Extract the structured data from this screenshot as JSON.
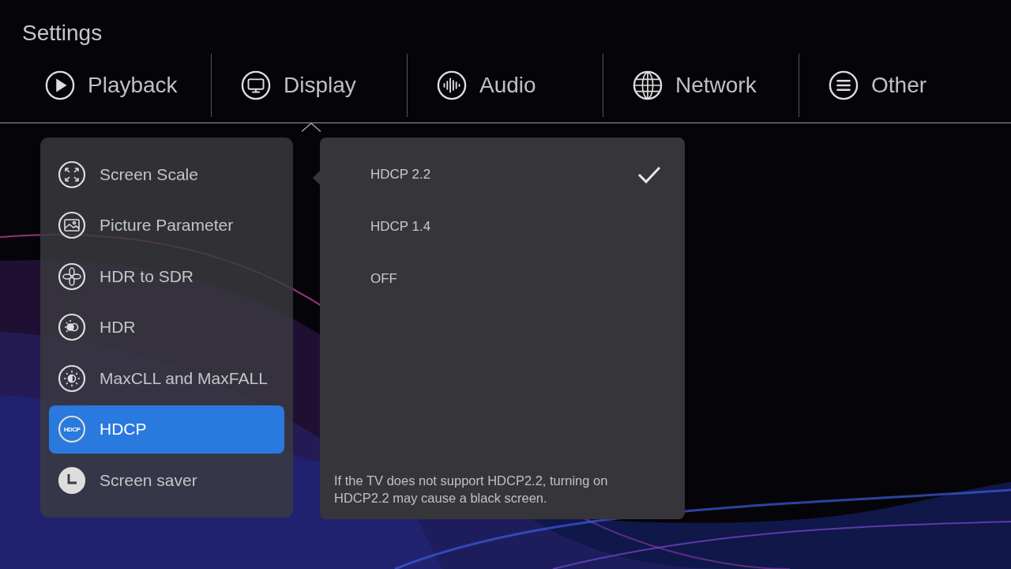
{
  "title": "Settings",
  "tabs": [
    {
      "label": "Playback",
      "selected": false
    },
    {
      "label": "Display",
      "selected": true
    },
    {
      "label": "Audio",
      "selected": false
    },
    {
      "label": "Network",
      "selected": false
    },
    {
      "label": "Other",
      "selected": false
    }
  ],
  "menu": [
    {
      "label": "Screen Scale",
      "selected": false
    },
    {
      "label": "Picture Parameter",
      "selected": false
    },
    {
      "label": "HDR to SDR",
      "selected": false
    },
    {
      "label": "HDR",
      "selected": false
    },
    {
      "label": "MaxCLL and MaxFALL",
      "selected": false
    },
    {
      "label": "HDCP",
      "icon_text": "HDCP",
      "selected": true
    },
    {
      "label": "Screen saver",
      "selected": false
    }
  ],
  "options": [
    {
      "label": "HDCP 2.2",
      "selected": true
    },
    {
      "label": "HDCP 1.4",
      "selected": false
    },
    {
      "label": "OFF",
      "selected": false
    }
  ],
  "note": "If the TV does not support HDCP2.2, turning on HDCP2.2 may cause a black screen."
}
